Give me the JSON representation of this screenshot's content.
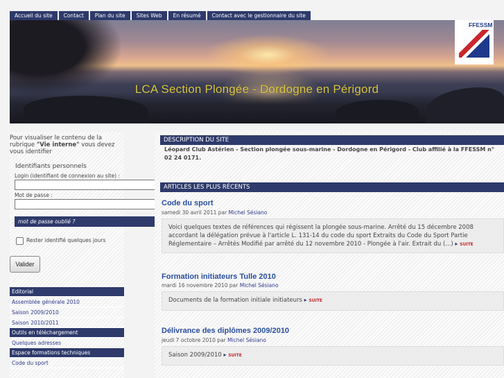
{
  "nav": {
    "items": [
      "Accueil du site",
      "Contact",
      "Plan du site",
      "Sites Web",
      "En résumé",
      "Contact avec le gestionnaire du site"
    ]
  },
  "banner": {
    "title": "LCA Section Plongée - Dordogne en Périgord",
    "logo_text": "FFESSM"
  },
  "sidebar": {
    "intro_before": "Pour visualiser le contenu de la rubrique ",
    "intro_bold": "\"Vie interne\"",
    "intro_after": " vous devez vous identifier",
    "ident_title": "Identifiants personnels",
    "login_label": "Login (identifiant de connexion au site) :",
    "password_label": "Mot de passe :",
    "forgot_label": "mot de passe oublié ?",
    "remember_label": "Rester identifié quelques jours",
    "validate_label": "Valider",
    "menu": [
      {
        "kind": "head",
        "label": "Editorial"
      },
      {
        "kind": "item",
        "label": "Assemblée générale 2010"
      },
      {
        "kind": "item",
        "label": "Saison 2009/2010"
      },
      {
        "kind": "item",
        "label": "Saison 2010/2011"
      },
      {
        "kind": "head",
        "label": "Outils en téléchargement"
      },
      {
        "kind": "item",
        "label": "Quelques adresses"
      },
      {
        "kind": "head",
        "label": "Espace formations techniques"
      },
      {
        "kind": "item",
        "label": "Code du sport"
      }
    ]
  },
  "main": {
    "desc_head": "DESCRIPTION DU SITE",
    "desc_text": "Léopard Club Astérien - Section plongée sous-marine - Dordogne en Périgord - Club affilié à la FFESSM n° 02 24 0171.",
    "articles_head": "ARTICLES LES PLUS RÉCENTS",
    "suite_label": "SUITE",
    "articles": [
      {
        "title": "Code du sport",
        "date": "samedi 30 avril 2011",
        "by": "par",
        "author": "Michel Sésiano",
        "excerpt": "Voici quelques textes de références qui régissent la plongée sous-marine. Arrêté du 15 décembre 2008 accordant la délégation prévue à l'article L. 131-14 du code du sport Extraits du Code du Sport Partie Réglementaire – Arrêtés Modifié par arrêté du 12 novembre 2010 - Plongée à l'air. Extrait du (...)"
      },
      {
        "title": "Formation initiateurs Tulle 2010",
        "date": "mardi 16 novembre 2010",
        "by": "par",
        "author": "Michel Sésiano",
        "excerpt": "Documents de la formation initiale initiateurs"
      },
      {
        "title": "Délivrance des diplômes 2009/2010",
        "date": "jeudi 7 octobre 2010",
        "by": "par",
        "author": "Michel Sésiano",
        "excerpt": "Saison 2009/2010"
      }
    ]
  }
}
